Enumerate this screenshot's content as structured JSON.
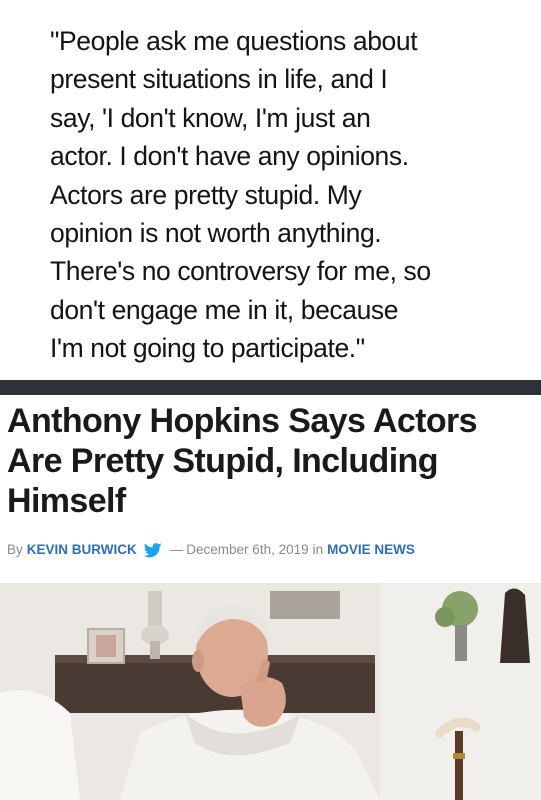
{
  "quote": {
    "lines": [
      "\"People ask me questions about",
      "present situations in life, and I",
      "say, 'I don't know, I'm just an",
      "actor. I don't have any opinions.",
      "Actors are pretty stupid. My",
      "opinion is not worth anything.",
      "There's no controversy for me, so",
      "don't engage me in it, because",
      "I'm not going to participate.\""
    ]
  },
  "article": {
    "headline_lines": [
      "Anthony Hopkins Says Actors",
      "Are Pretty Stupid, Including",
      "Himself"
    ],
    "byline": {
      "by": "By",
      "author": "KEVIN BURWICK",
      "dash": "—",
      "date": "December 6th, 2019",
      "in": "in",
      "category": "MOVIE NEWS"
    }
  },
  "colors": {
    "divider": "#2d3238",
    "link": "#2f6fb5",
    "twitter": "#1da1f2"
  },
  "icons": {
    "twitter": "twitter-bird-icon"
  }
}
